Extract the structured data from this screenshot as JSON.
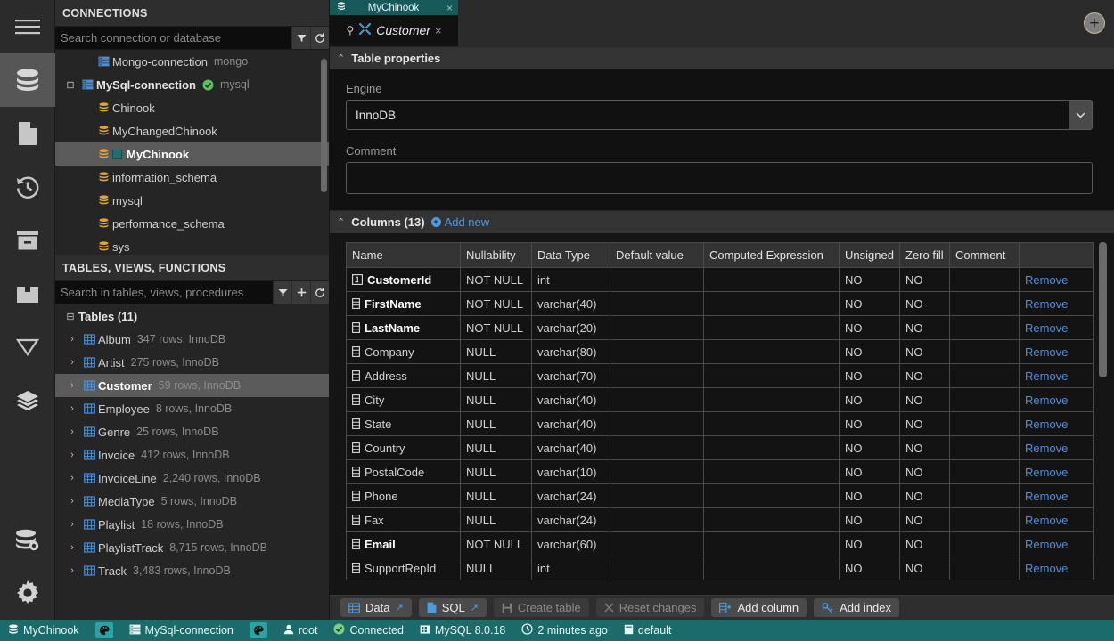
{
  "rail": {
    "items": [
      {
        "name": "menu-icon",
        "label": "Menu",
        "active": false
      },
      {
        "name": "database-icon",
        "label": "Databases",
        "active": true
      },
      {
        "name": "file-icon",
        "label": "Files",
        "active": false
      },
      {
        "name": "history-icon",
        "label": "History",
        "active": false
      },
      {
        "name": "archive-icon",
        "label": "Archive",
        "active": false
      },
      {
        "name": "folder-icon",
        "label": "Folders",
        "active": false
      },
      {
        "name": "filter-icon",
        "label": "Filters",
        "active": false
      },
      {
        "name": "layers-icon",
        "label": "Layers",
        "active": false
      }
    ],
    "bottom_items": [
      {
        "name": "data-explorer-icon",
        "label": "Data explorer"
      },
      {
        "name": "gear-icon",
        "label": "Settings"
      }
    ]
  },
  "connections": {
    "title": "CONNECTIONS",
    "search": {
      "value": "",
      "placeholder": "Search connection or database"
    },
    "buttons": [
      {
        "name": "filter-icon",
        "label": "Filter"
      },
      {
        "name": "refresh-icon",
        "label": "Refresh"
      }
    ],
    "nodes": [
      {
        "indent": 1,
        "expander": "",
        "icon": "server-icon",
        "label": "Mongo-connection",
        "meta": "mongo",
        "bold": false,
        "selected": false,
        "chip": false
      },
      {
        "indent": 0,
        "expander": "minus",
        "icon": "server-icon",
        "label": "MySql-connection",
        "meta": "mysql",
        "bold": true,
        "selected": false,
        "chip": false,
        "status": "connected"
      },
      {
        "indent": 1,
        "expander": "",
        "icon": "db-icon",
        "label": "Chinook",
        "meta": "",
        "bold": false,
        "selected": false,
        "chip": false
      },
      {
        "indent": 1,
        "expander": "",
        "icon": "db-icon",
        "label": "MyChangedChinook",
        "meta": "",
        "bold": false,
        "selected": false,
        "chip": false
      },
      {
        "indent": 1,
        "expander": "",
        "icon": "db-icon",
        "label": "MyChinook",
        "meta": "",
        "bold": true,
        "selected": true,
        "chip": true
      },
      {
        "indent": 1,
        "expander": "",
        "icon": "db-icon",
        "label": "information_schema",
        "meta": "",
        "bold": false,
        "selected": false,
        "chip": false
      },
      {
        "indent": 1,
        "expander": "",
        "icon": "db-icon",
        "label": "mysql",
        "meta": "",
        "bold": false,
        "selected": false,
        "chip": false
      },
      {
        "indent": 1,
        "expander": "",
        "icon": "db-icon",
        "label": "performance_schema",
        "meta": "",
        "bold": false,
        "selected": false,
        "chip": false
      },
      {
        "indent": 1,
        "expander": "",
        "icon": "db-icon",
        "label": "sys",
        "meta": "",
        "bold": false,
        "selected": false,
        "chip": false
      }
    ]
  },
  "objects": {
    "title": "TABLES, VIEWS, FUNCTIONS",
    "search": {
      "value": "",
      "placeholder": "Search in tables, views, procedures"
    },
    "buttons": [
      {
        "name": "filter-icon",
        "label": "Filter"
      },
      {
        "name": "add-icon",
        "label": "Add"
      },
      {
        "name": "refresh-icon",
        "label": "Refresh"
      }
    ],
    "group_label": "Tables (11)",
    "tables": [
      {
        "name": "Album",
        "meta": "347 rows, InnoDB",
        "selected": false
      },
      {
        "name": "Artist",
        "meta": "275 rows, InnoDB",
        "selected": false
      },
      {
        "name": "Customer",
        "meta": "59 rows, InnoDB",
        "selected": true
      },
      {
        "name": "Employee",
        "meta": "8 rows, InnoDB",
        "selected": false
      },
      {
        "name": "Genre",
        "meta": "25 rows, InnoDB",
        "selected": false
      },
      {
        "name": "Invoice",
        "meta": "412 rows, InnoDB",
        "selected": false
      },
      {
        "name": "InvoiceLine",
        "meta": "2,240 rows, InnoDB",
        "selected": false
      },
      {
        "name": "MediaType",
        "meta": "5 rows, InnoDB",
        "selected": false
      },
      {
        "name": "Playlist",
        "meta": "18 rows, InnoDB",
        "selected": false
      },
      {
        "name": "PlaylistTrack",
        "meta": "8,715 rows, InnoDB",
        "selected": false
      },
      {
        "name": "Track",
        "meta": "3,483 rows, InnoDB",
        "selected": false
      }
    ]
  },
  "tabs": {
    "database_tab": {
      "label": "MyChinook",
      "close": "×"
    },
    "object_tab": {
      "label": "Customer",
      "close": "×"
    },
    "add_tab_label": "+"
  },
  "table_properties": {
    "section_label": "Table properties",
    "engine_label": "Engine",
    "engine_value": "InnoDB",
    "comment_label": "Comment",
    "comment_value": ""
  },
  "columns_section": {
    "section_label": "Columns (13)",
    "add_new_label": "Add new",
    "headers": [
      "Name",
      "Nullability",
      "Data Type",
      "Default value",
      "Computed Expression",
      "Unsigned",
      "Zero fill",
      "Comment",
      ""
    ],
    "remove_label": "Remove",
    "rows": [
      {
        "name": "CustomerId",
        "icon": "primary-key-icon",
        "required": true,
        "nullability": "NOT NULL",
        "data_type": "int",
        "default_value": "",
        "computed_expression": "",
        "unsigned": "NO",
        "zero_fill": "NO",
        "comment": ""
      },
      {
        "name": "FirstName",
        "icon": "column-icon",
        "required": true,
        "nullability": "NOT NULL",
        "data_type": "varchar(40)",
        "default_value": "",
        "computed_expression": "",
        "unsigned": "NO",
        "zero_fill": "NO",
        "comment": ""
      },
      {
        "name": "LastName",
        "icon": "column-icon",
        "required": true,
        "nullability": "NOT NULL",
        "data_type": "varchar(20)",
        "default_value": "",
        "computed_expression": "",
        "unsigned": "NO",
        "zero_fill": "NO",
        "comment": ""
      },
      {
        "name": "Company",
        "icon": "column-icon",
        "required": false,
        "nullability": "NULL",
        "data_type": "varchar(80)",
        "default_value": "",
        "computed_expression": "",
        "unsigned": "NO",
        "zero_fill": "NO",
        "comment": ""
      },
      {
        "name": "Address",
        "icon": "column-icon",
        "required": false,
        "nullability": "NULL",
        "data_type": "varchar(70)",
        "default_value": "",
        "computed_expression": "",
        "unsigned": "NO",
        "zero_fill": "NO",
        "comment": ""
      },
      {
        "name": "City",
        "icon": "column-icon",
        "required": false,
        "nullability": "NULL",
        "data_type": "varchar(40)",
        "default_value": "",
        "computed_expression": "",
        "unsigned": "NO",
        "zero_fill": "NO",
        "comment": ""
      },
      {
        "name": "State",
        "icon": "column-icon",
        "required": false,
        "nullability": "NULL",
        "data_type": "varchar(40)",
        "default_value": "",
        "computed_expression": "",
        "unsigned": "NO",
        "zero_fill": "NO",
        "comment": ""
      },
      {
        "name": "Country",
        "icon": "column-icon",
        "required": false,
        "nullability": "NULL",
        "data_type": "varchar(40)",
        "default_value": "",
        "computed_expression": "",
        "unsigned": "NO",
        "zero_fill": "NO",
        "comment": ""
      },
      {
        "name": "PostalCode",
        "icon": "column-icon",
        "required": false,
        "nullability": "NULL",
        "data_type": "varchar(10)",
        "default_value": "",
        "computed_expression": "",
        "unsigned": "NO",
        "zero_fill": "NO",
        "comment": ""
      },
      {
        "name": "Phone",
        "icon": "column-icon",
        "required": false,
        "nullability": "NULL",
        "data_type": "varchar(24)",
        "default_value": "",
        "computed_expression": "",
        "unsigned": "NO",
        "zero_fill": "NO",
        "comment": ""
      },
      {
        "name": "Fax",
        "icon": "column-icon",
        "required": false,
        "nullability": "NULL",
        "data_type": "varchar(24)",
        "default_value": "",
        "computed_expression": "",
        "unsigned": "NO",
        "zero_fill": "NO",
        "comment": ""
      },
      {
        "name": "Email",
        "icon": "column-icon",
        "required": true,
        "nullability": "NOT NULL",
        "data_type": "varchar(60)",
        "default_value": "",
        "computed_expression": "",
        "unsigned": "NO",
        "zero_fill": "NO",
        "comment": ""
      },
      {
        "name": "SupportRepId",
        "icon": "column-icon",
        "required": false,
        "nullability": "NULL",
        "data_type": "int",
        "default_value": "",
        "computed_expression": "",
        "unsigned": "NO",
        "zero_fill": "NO",
        "comment": ""
      }
    ]
  },
  "toolbar": {
    "buttons": [
      {
        "name": "data-button",
        "label": "Data",
        "icon": "grid-icon",
        "external": true,
        "disabled": false
      },
      {
        "name": "sql-button",
        "label": "SQL",
        "icon": "file-icon",
        "external": true,
        "disabled": false
      },
      {
        "name": "create-table-button",
        "label": "Create table",
        "icon": "save-icon",
        "external": false,
        "disabled": true
      },
      {
        "name": "reset-changes-button",
        "label": "Reset changes",
        "icon": "x-icon",
        "external": false,
        "disabled": true
      },
      {
        "name": "add-column-button",
        "label": "Add column",
        "icon": "add-column-icon",
        "external": false,
        "disabled": false
      },
      {
        "name": "add-index-button",
        "label": "Add index",
        "icon": "key-icon",
        "external": false,
        "disabled": false
      }
    ]
  },
  "statusbar": {
    "database": "MyChinook",
    "connection": "MySql-connection",
    "user": "root",
    "connection_state": "Connected",
    "server_version": "MySQL 8.0.18",
    "last_refresh": "2 minutes ago",
    "schema": "default"
  },
  "colors": {
    "accent_teal": "#1b6b6b",
    "link_blue": "#4e9bdd",
    "selection_gray": "#5b5b5b",
    "status_green": "#7ed07e"
  }
}
